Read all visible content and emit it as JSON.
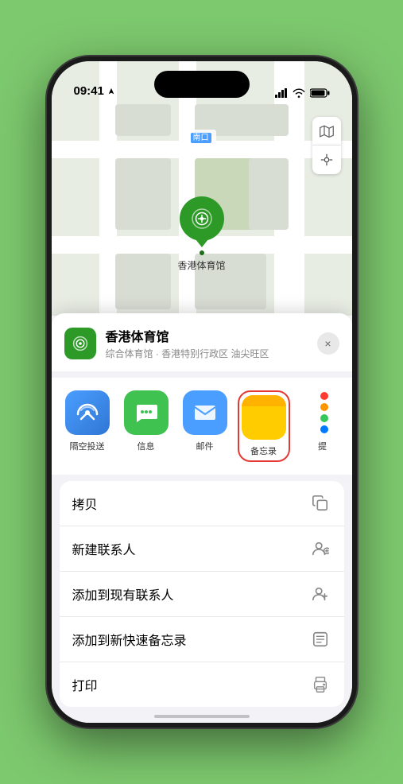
{
  "status_bar": {
    "time": "09:41",
    "location_arrow": true
  },
  "map": {
    "label_south_entrance": "南口",
    "pin_label": "香港体育馆",
    "map_btn_map": "🗺",
    "map_btn_location": "➤"
  },
  "location_card": {
    "name": "香港体育馆",
    "subtitle": "综合体育馆 · 香港特别行政区 油尖旺区",
    "close_label": "×"
  },
  "share_actions": [
    {
      "id": "airdrop",
      "label": "隔空投送",
      "icon_type": "airdrop"
    },
    {
      "id": "message",
      "label": "信息",
      "icon_type": "message"
    },
    {
      "id": "mail",
      "label": "邮件",
      "icon_type": "mail"
    },
    {
      "id": "notes",
      "label": "备忘录",
      "icon_type": "notes"
    },
    {
      "id": "more",
      "label": "提",
      "icon_type": "more"
    }
  ],
  "action_items": [
    {
      "id": "copy",
      "label": "拷贝",
      "icon": "copy"
    },
    {
      "id": "new-contact",
      "label": "新建联系人",
      "icon": "person-plus"
    },
    {
      "id": "add-existing",
      "label": "添加到现有联系人",
      "icon": "person-add"
    },
    {
      "id": "quick-note",
      "label": "添加到新快速备忘录",
      "icon": "note"
    },
    {
      "id": "print",
      "label": "打印",
      "icon": "print"
    }
  ]
}
